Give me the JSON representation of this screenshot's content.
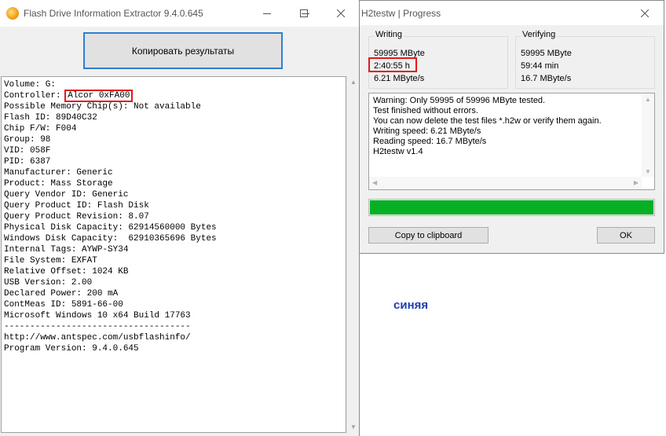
{
  "fdie": {
    "title": "Flash Drive Information Extractor 9.4.0.645",
    "copy_button": "Копировать результаты",
    "lines_before": [
      "Volume: G:"
    ],
    "controller_label": "Controller: ",
    "controller_value": "Alcor 0xFA00",
    "lines_after": [
      "Possible Memory Chip(s): Not available",
      "Flash ID: 89D40C32",
      "Chip F/W: F004",
      "Group: 98",
      "VID: 058F",
      "PID: 6387",
      "Manufacturer: Generic",
      "Product: Mass Storage",
      "Query Vendor ID: Generic",
      "Query Product ID: Flash Disk",
      "Query Product Revision: 8.07",
      "Physical Disk Capacity: 62914560000 Bytes",
      "Windows Disk Capacity:  62910365696 Bytes",
      "Internal Tags: AYWP-SY34",
      "File System: EXFAT",
      "Relative Offset: 1024 KB",
      "USB Version: 2.00",
      "Declared Power: 200 mA",
      "ContMeas ID: 5891-66-00",
      "Microsoft Windows 10 x64 Build 17763",
      "------------------------------------",
      "http://www.antspec.com/usbflashinfo/",
      "Program Version: 9.4.0.645"
    ]
  },
  "h2testw": {
    "title": "H2testw | Progress",
    "writing": {
      "label": "Writing",
      "size": "59995 MByte",
      "time": "2:40:55 h",
      "speed": "6.21 MByte/s"
    },
    "verifying": {
      "label": "Verifying",
      "size": "59995 MByte",
      "time": "59:44 min",
      "speed": "16.7 MByte/s"
    },
    "log": [
      "Warning: Only 59995 of 59996 MByte tested.",
      "Test finished without errors.",
      "You can now delete the test files *.h2w or verify them again.",
      "Writing speed: 6.21 MByte/s",
      "Reading speed: 16.7 MByte/s",
      "H2testw v1.4"
    ],
    "progress_fraction": 1.0,
    "copy_button": "Copy to clipboard",
    "ok_button": "OK"
  },
  "annotation": {
    "word": "синяя",
    "color": "#1f3fb0",
    "highlight_color": "#e0191f"
  },
  "colors": {
    "progress_green": "#06b025",
    "focus_blue": "#2c7fd1"
  },
  "icons": [
    "app-sun-icon",
    "minimize-icon",
    "maximize-icon",
    "close-icon",
    "scroll-up-icon",
    "scroll-down-icon",
    "scroll-left-icon",
    "scroll-right-icon"
  ]
}
